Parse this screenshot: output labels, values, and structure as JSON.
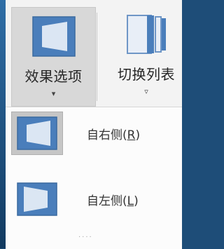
{
  "ribbon": {
    "effect_options": {
      "label": "效果选项",
      "arrow": "▾"
    },
    "switch_list": {
      "label": "切换列表",
      "arrow": "▿"
    }
  },
  "menu": {
    "items": [
      {
        "label_main": "自右侧(",
        "mnemonic": "R",
        "label_end": ")",
        "icon": "flip-from-right-icon",
        "selected": true
      },
      {
        "label_main": "自左侧(",
        "mnemonic": "L",
        "label_end": ")",
        "icon": "flip-from-left-icon",
        "selected": false
      }
    ]
  },
  "grip": "....",
  "colors": {
    "icon_blue": "#4a7ebb",
    "icon_light": "#dbe6f3",
    "selected_bg": "#c6c6c6"
  }
}
